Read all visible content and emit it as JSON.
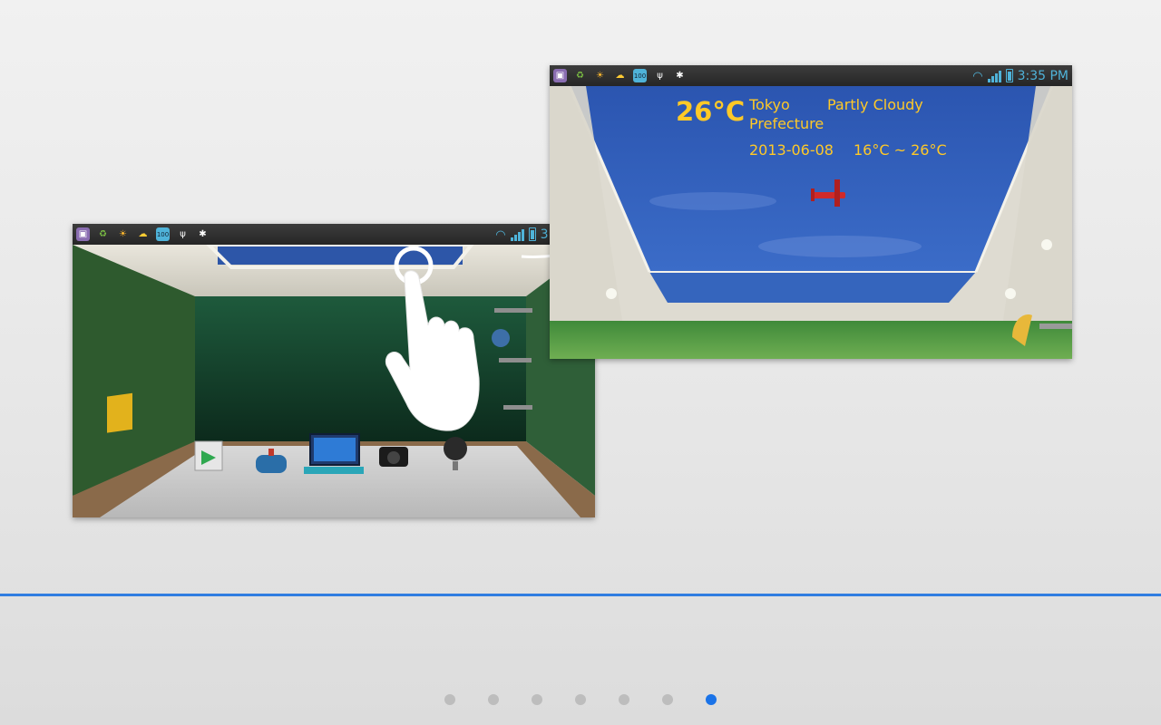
{
  "status_bar": {
    "time": "3:35 PM",
    "battery_level": "100"
  },
  "weather": {
    "temperature": "26°C",
    "city_line1": "Tokyo",
    "city_line2": "Prefecture",
    "condition": "Partly Cloudy",
    "date": "2013-06-08",
    "range": "16°C ~ 26°C"
  },
  "pagination": {
    "count": 7,
    "active_index": 6
  },
  "colors": {
    "accent": "#1a73e8",
    "divider": "#2f7de1",
    "weather_text": "#ffc927",
    "status_text": "#4fb3d9"
  }
}
